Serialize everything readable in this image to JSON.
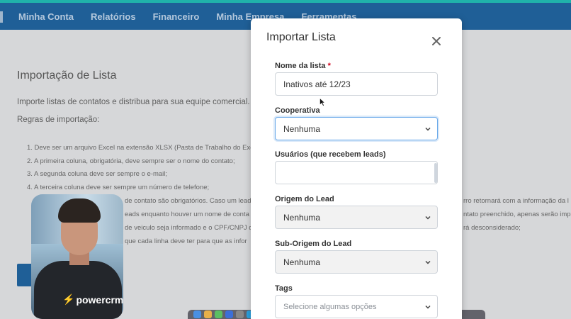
{
  "nav": {
    "items": [
      "Minha Conta",
      "Relatórios",
      "Financeiro",
      "Minha Empresa",
      "Ferramentas"
    ]
  },
  "background": {
    "title": "Importação de Lista",
    "description": "Importe listas de contatos e distribua para sua equipe comercial.",
    "rules_heading": "Regras de importação:",
    "rules": [
      "1. Deve ser um arquivo Excel na extensão XLSX (Pasta de Trabalho do Exc",
      "2. A primeira coluna, obrigatória, deve sempre ser o nome do contato;",
      "3. A segunda coluna deve ser sempre o e-mail;",
      "4. A terceira coluna deve ser sempre um número de telefone;",
      "de contato são obrigatórios. Caso um lead",
      "rro retornará com a informação da l",
      "eads enquanto houver um nome de conta",
      "ntato preenchido, apenas serão impo",
      "de veiculo seja informado e o CPF/CNPJ d",
      "rá desconsiderado;",
      "que cada linha deve ter para que as infor"
    ]
  },
  "webcam": {
    "logo_text": "powercrm"
  },
  "modal": {
    "title": "Importar Lista",
    "fields": {
      "nome_lista": {
        "label": "Nome da lista",
        "required_mark": "*",
        "value": "Inativos até 12/23"
      },
      "cooperativa": {
        "label": "Cooperativa",
        "value": "Nenhuma"
      },
      "usuarios": {
        "label": "Usuários (que recebem leads)",
        "value": ""
      },
      "origem": {
        "label": "Origem do Lead",
        "value": "Nenhuma"
      },
      "sub_origem": {
        "label": "Sub-Origem do Lead",
        "value": "Nenhuma"
      },
      "tags": {
        "label": "Tags",
        "placeholder": "Selecione algumas opções"
      }
    }
  },
  "colors": {
    "nav_bg": "#1f5f97",
    "accent_top": "#20b2aa",
    "focus_border": "#6aa9e9",
    "required": "#d0021b"
  },
  "icons": {
    "close": "close-icon",
    "select": "chevron-down-icon",
    "logo": "powercrm-bolt-icon"
  }
}
